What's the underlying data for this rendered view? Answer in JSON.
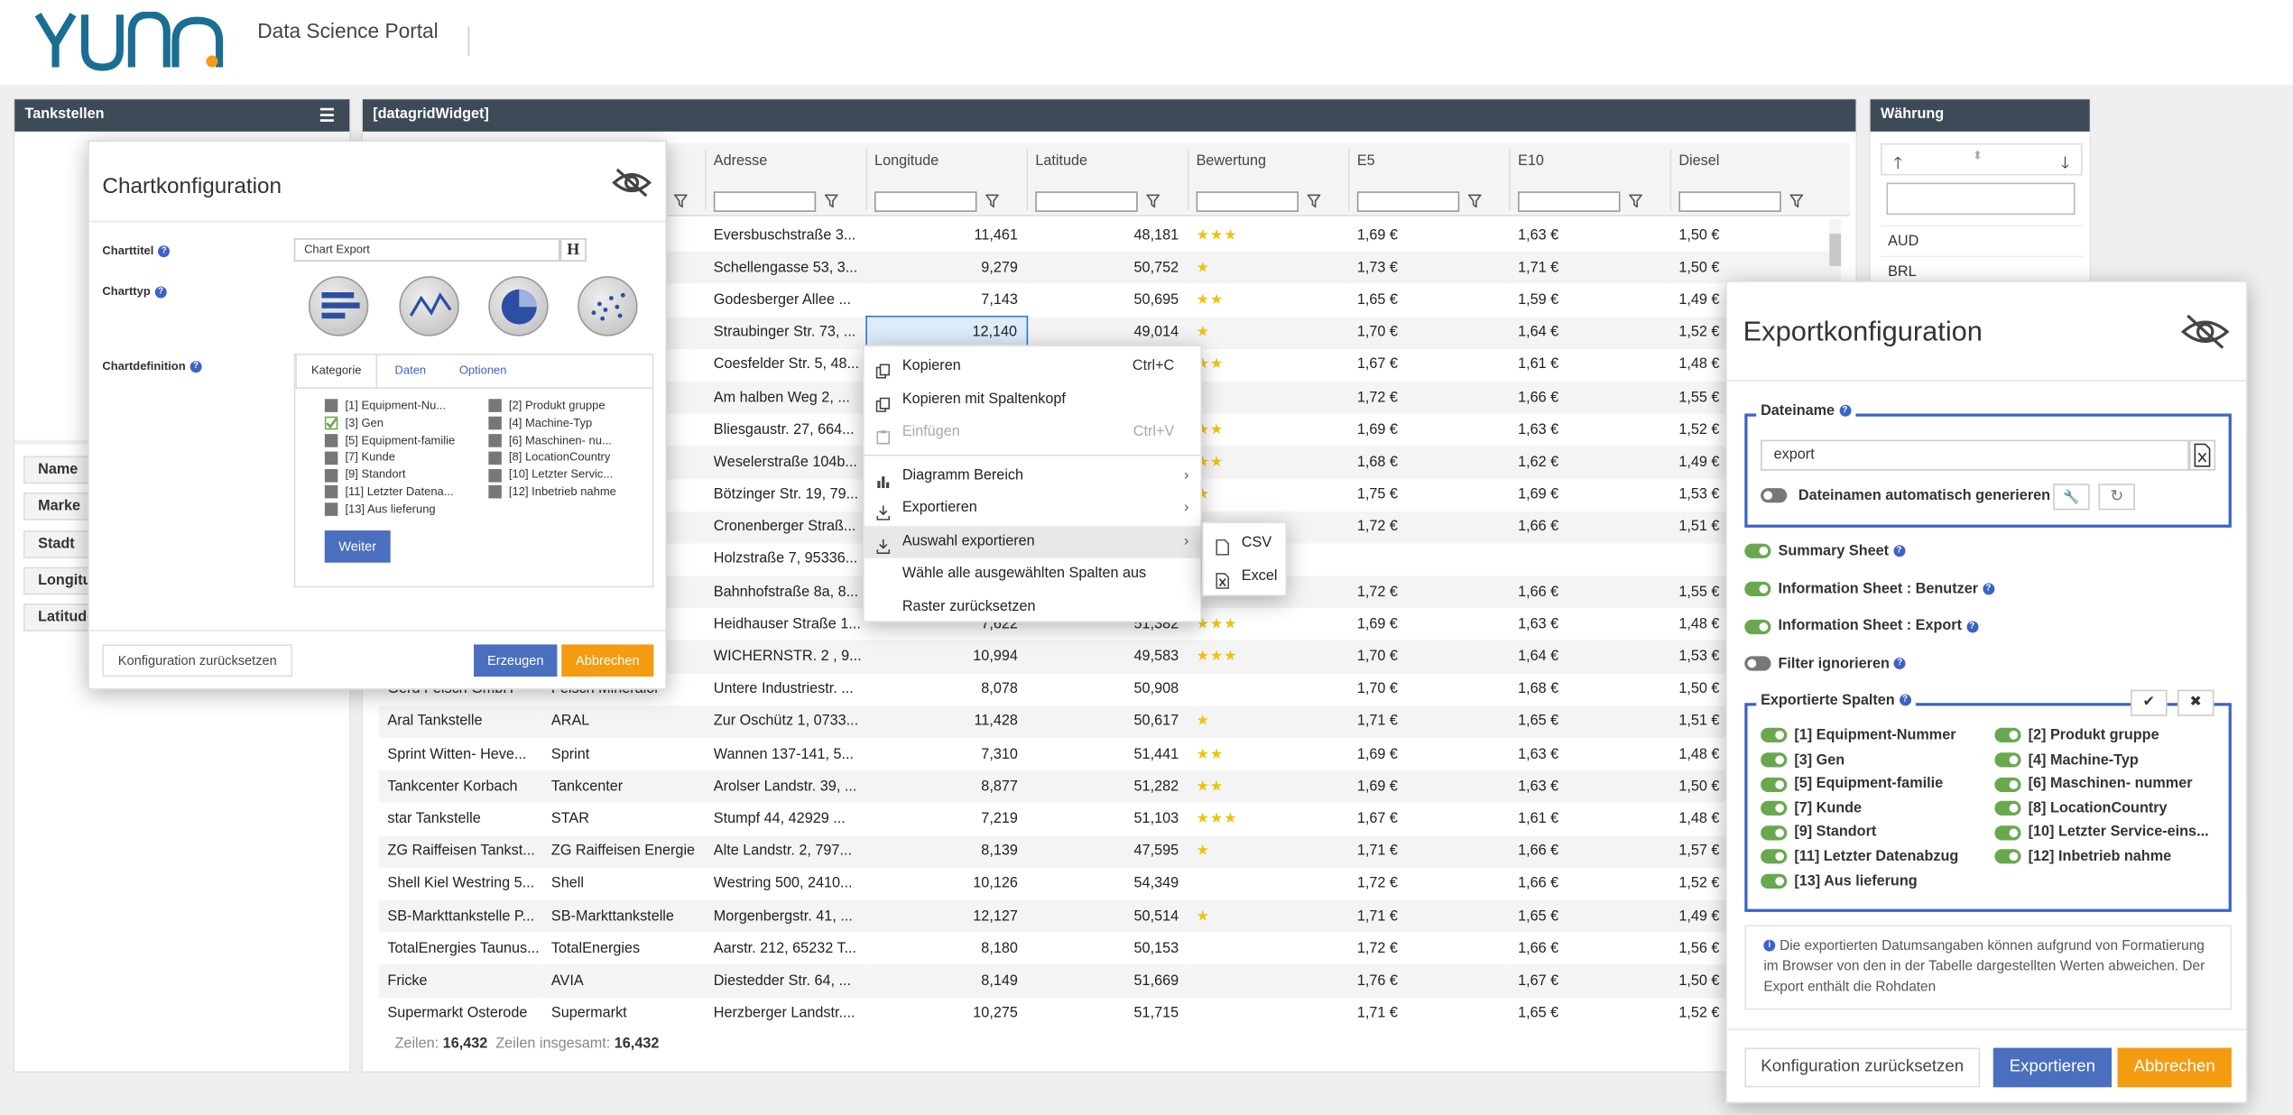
{
  "header": {
    "logo": "YUNA",
    "title": "Data Science Portal"
  },
  "tankstellen": {
    "title": "Tankstellen",
    "filters": [
      "Name",
      "Marke",
      "Stadt",
      "Longitu",
      "Latitude"
    ]
  },
  "grid": {
    "title": "[datagridWidget]",
    "columns": [
      "Adresse",
      "Longitude",
      "Latitude",
      "Bewertung",
      "E5",
      "E10",
      "Diesel"
    ],
    "rows": [
      [
        "",
        "",
        "Eversbuschstraße 3...",
        "11,461",
        "48,181",
        "★★★",
        "1,69 €",
        "1,63 €",
        "1,50 €"
      ],
      [
        "",
        "",
        "Schellengasse 53, 3...",
        "9,279",
        "50,752",
        "★",
        "1,73 €",
        "1,71 €",
        "1,50 €"
      ],
      [
        "",
        "",
        "Godesberger Allee ...",
        "7,143",
        "50,695",
        "★★",
        "1,65 €",
        "1,59 €",
        "1,49 €"
      ],
      [
        "",
        "",
        "Straubinger Str. 73, ...",
        "12,140",
        "49,014",
        "★",
        "1,70 €",
        "1,64 €",
        "1,52 €"
      ],
      [
        "",
        "",
        "Coesfelder Str. 5, 48...",
        "",
        "",
        "★★",
        "1,67 €",
        "1,61 €",
        "1,48 €"
      ],
      [
        "",
        "",
        "Am halben Weg 2, ...",
        "",
        "",
        "",
        "1,72 €",
        "1,66 €",
        "1,55 €"
      ],
      [
        "",
        "",
        "Bliesgaustr. 27, 664...",
        "",
        "",
        "★★",
        "1,69 €",
        "1,63 €",
        "1,52 €"
      ],
      [
        "",
        "",
        "Weselerstraße 104b...",
        "",
        "",
        "★★",
        "1,68 €",
        "1,62 €",
        "1,49 €"
      ],
      [
        "",
        "",
        "Bötzinger Str. 19, 79...",
        "",
        "",
        "★",
        "1,75 €",
        "1,69 €",
        "1,53 €"
      ],
      [
        "",
        "",
        "Cronenberger Straß...",
        "",
        "",
        "★",
        "1,72 €",
        "1,66 €",
        "1,51 €"
      ],
      [
        "",
        "a...",
        "Holzstraße 7, 95336...",
        "",
        "",
        "",
        "",
        "",
        ""
      ],
      [
        "",
        "",
        "Bahnhofstraße 8a, 8...",
        "",
        "",
        "",
        "1,72 €",
        "1,66 €",
        "1,55 €"
      ],
      [
        "",
        "",
        "Heidhauser Straße 1...",
        "7,622",
        "51,382",
        "★★★",
        "1,69 €",
        "1,63 €",
        "1,48 €"
      ],
      [
        "",
        "",
        "WICHERNSTR. 2 , 9...",
        "10,994",
        "49,583",
        "★★★",
        "1,70 €",
        "1,64 €",
        "1,53 €"
      ],
      [
        "Gerd Feisch GmbH",
        "Feisch Mineralöl",
        "Untere Industriestr. ...",
        "8,078",
        "50,908",
        "",
        "1,70 €",
        "1,68 €",
        "1,50 €"
      ],
      [
        "Aral Tankstelle",
        "ARAL",
        "Zur Oschütz 1, 0733...",
        "11,428",
        "50,617",
        "★",
        "1,71 €",
        "1,65 €",
        "1,51 €"
      ],
      [
        "Sprint Witten- Heve...",
        "Sprint",
        "Wannen 137-141, 5...",
        "7,310",
        "51,441",
        "★★",
        "1,69 €",
        "1,63 €",
        "1,48 €"
      ],
      [
        "Tankcenter Korbach",
        "Tankcenter",
        "Arolser Landstr. 39, ...",
        "8,877",
        "51,282",
        "★★",
        "1,69 €",
        "1,63 €",
        "1,50 €"
      ],
      [
        "star Tankstelle",
        "STAR",
        "Stumpf 44, 42929 ...",
        "7,219",
        "51,103",
        "★★★",
        "1,67 €",
        "1,61 €",
        "1,48 €"
      ],
      [
        "ZG Raiffeisen Tankst...",
        "ZG Raiffeisen Energie",
        "Alte Landstr. 2, 797...",
        "8,139",
        "47,595",
        "★",
        "1,71 €",
        "1,66 €",
        "1,57 €"
      ],
      [
        "Shell Kiel Westring 5...",
        "Shell",
        "Westring 500, 2410...",
        "10,126",
        "54,349",
        "",
        "1,72 €",
        "1,66 €",
        "1,52 €"
      ],
      [
        "SB-Markttankstelle P...",
        "SB-Markttankstelle",
        "Morgenbergstr. 41, ...",
        "12,127",
        "50,514",
        "★",
        "1,71 €",
        "1,65 €",
        "1,49 €"
      ],
      [
        "TotalEnergies Taunus...",
        "TotalEnergies",
        "Aarstr. 212, 65232 T...",
        "8,180",
        "50,153",
        "",
        "1,72 €",
        "1,66 €",
        "1,56 €"
      ],
      [
        "Fricke",
        "AVIA",
        "Diestedder Str. 64, ...",
        "8,149",
        "51,669",
        "",
        "1,76 €",
        "1,67 €",
        "1,50 €"
      ],
      [
        "Supermarkt Osterode",
        "Supermarkt",
        "Herzberger Landstr....",
        "10,275",
        "51,715",
        "",
        "1,71 €",
        "1,65 €",
        "1,52 €"
      ]
    ],
    "footer": {
      "rows_label": "Zeilen:",
      "rows_value": "16,432",
      "total_label": "Zeilen insgesamt:",
      "total_value": "16,432"
    }
  },
  "waehrung": {
    "title": "Währung",
    "items": [
      "AUD",
      "BRL"
    ]
  },
  "chartconfig": {
    "title": "Chartkonfiguration",
    "charttitel_label": "Charttitel",
    "charttitel_value": "Chart Export",
    "charttyp_label": "Charttyp",
    "chartdef_label": "Chartdefinition",
    "tabs": [
      "Kategorie",
      "Daten",
      "Optionen"
    ],
    "cats_left": [
      "[1] Equipment-Nu...",
      "[3] Gen",
      "[5] Equipment-familie",
      "[7] Kunde",
      "[9] Standort",
      "[11] Letzter Datena...",
      "[13] Aus lieferung"
    ],
    "cats_right": [
      "[2] Produkt gruppe",
      "[4] Machine-Typ",
      "[6] Maschinen- nu...",
      "[8] LocationCountry",
      "[10] Letzter Servic...",
      "[12] Inbetrieb nahme"
    ],
    "weiter": "Weiter",
    "reset": "Konfiguration zurücksetzen",
    "erzeugen": "Erzeugen",
    "abbrechen": "Abbrechen"
  },
  "context_menu": {
    "items": [
      {
        "label": "Kopieren",
        "shortcut": "Ctrl+C"
      },
      {
        "label": "Kopieren mit Spaltenkopf",
        "shortcut": ""
      },
      {
        "label": "Einfügen",
        "shortcut": "Ctrl+V"
      },
      {
        "label": "Diagramm Bereich",
        "shortcut": ""
      },
      {
        "label": "Exportieren",
        "shortcut": ""
      },
      {
        "label": "Auswahl exportieren",
        "shortcut": ""
      },
      {
        "label": "Wähle alle ausgewählten Spalten aus",
        "shortcut": ""
      },
      {
        "label": "Raster zurücksetzen",
        "shortcut": ""
      }
    ],
    "submenu": [
      "CSV",
      "Excel"
    ]
  },
  "exportconfig": {
    "title": "Exportkonfiguration",
    "dateiname_label": "Dateiname",
    "dateiname_value": "export",
    "auto_label": "Dateinamen automatisch generieren",
    "toggles": [
      "Summary Sheet",
      "Information Sheet : Benutzer",
      "Information Sheet : Export",
      "Filter ignorieren"
    ],
    "cols_label": "Exportierte Spalten",
    "cols_left": [
      "[1] Equipment-Nummer",
      "[3] Gen",
      "[5] Equipment-familie",
      "[7] Kunde",
      "[9] Standort",
      "[11] Letzter Datenabzug",
      "[13] Aus lieferung"
    ],
    "cols_right": [
      "[2] Produkt gruppe",
      "[4] Machine-Typ",
      "[6] Maschinen- nummer",
      "[8] LocationCountry",
      "[10] Letzter Service-eins...",
      "[12] Inbetrieb nahme"
    ],
    "info": "Die exportierten Datumsangaben können aufgrund von Formatierung im Browser von den in der Tabelle dargestellten Werten abweichen. Der Export enthält die Rohdaten",
    "reset": "Konfiguration zurücksetzen",
    "exportieren": "Exportieren",
    "abbrechen": "Abbrechen"
  },
  "colors": {
    "blue": "#4a6fbf",
    "orange": "#f39c12",
    "green": "#6aa84f",
    "header": "#3e4a58"
  }
}
